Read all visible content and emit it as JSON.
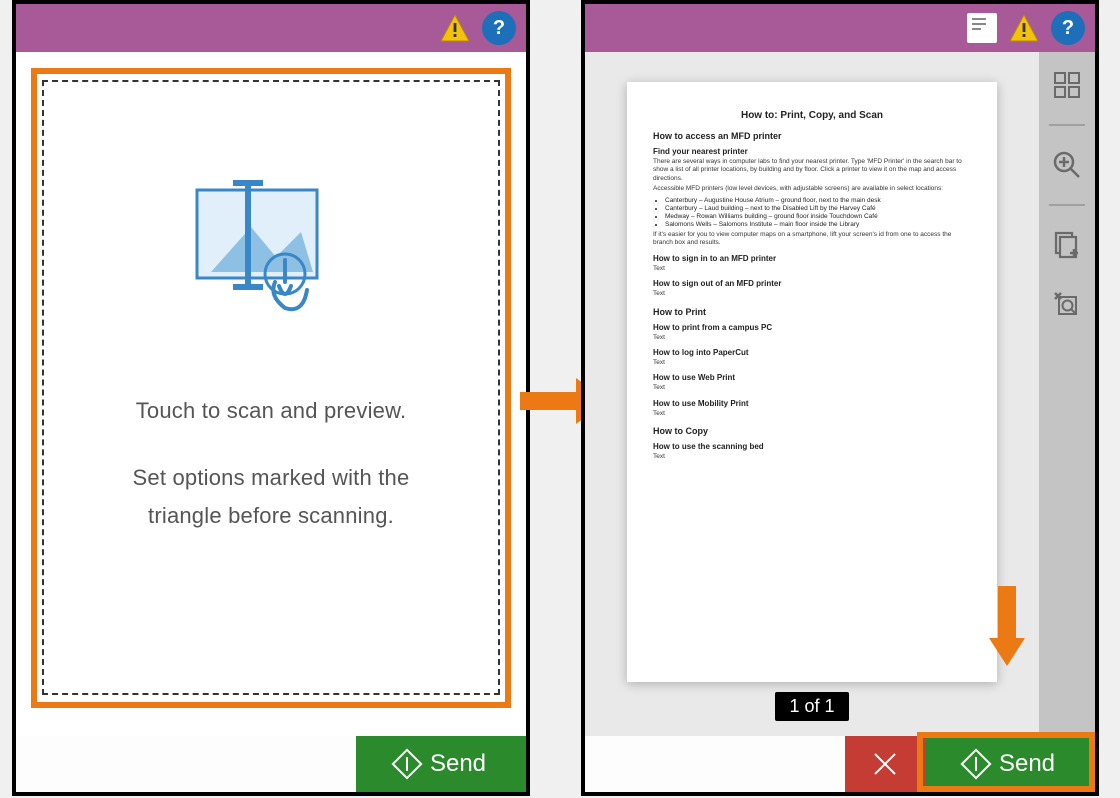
{
  "colors": {
    "header_purple": "#a75a97",
    "highlight_orange": "#ec7a14",
    "send_green": "#2b8a2b",
    "cancel_red": "#c43c33",
    "help_blue": "#1d6fba"
  },
  "icons": {
    "warning": "warning-triangle",
    "help": "help-circle",
    "document": "document-icon",
    "grid": "grid-icon",
    "zoom_in": "zoom-in-icon",
    "add_page": "add-page-icon",
    "clear_crop": "clear-crop-icon",
    "close": "close-x-icon",
    "send_marker": "diamond-send-icon"
  },
  "left": {
    "instruction_line1": "Touch to scan and preview.",
    "instruction_line2a": "Set options marked with the",
    "instruction_line2b": "triangle before scanning.",
    "send_label": "Send"
  },
  "right": {
    "page_counter": "1 of 1",
    "send_label": "Send",
    "document": {
      "title": "How to: Print, Copy, and Scan",
      "h2_access": "How to access an MFD printer",
      "h3_find": "Find your nearest printer",
      "p_find": "There are several ways in computer labs to find your nearest printer. Type 'MFD Printer' in the search bar to show a list of all printer locations, by building and by floor. Click a printer to view it on the map and access directions.",
      "p_accessible": "Accessible MFD printers (low level devices, with adjustable screens) are available in select locations:",
      "bullets": [
        "Canterbury – Augustine House Atrium – ground floor, next to the main desk",
        "Canterbury – Laud building – next to the Disabled Lift by the Harvey Café",
        "Medway – Rowan Williams building – ground floor inside Touchdown Café",
        "Salomons Wells – Salomons Institute – main floor inside the Library"
      ],
      "p_view": "If it's easier for you to view computer maps on a smartphone, lift your screen's id from one to access the branch box and results.",
      "sections": [
        {
          "h": "How to sign in to an MFD printer",
          "body": "Text"
        },
        {
          "h": "How to sign out of an MFD printer",
          "body": "Text"
        }
      ],
      "h2_print": "How to Print",
      "print_sections": [
        {
          "h": "How to print from a campus PC",
          "body": "Text"
        },
        {
          "h": "How to log into PaperCut",
          "body": "Text"
        },
        {
          "h": "How to use Web Print",
          "body": "Text"
        },
        {
          "h": "How to use Mobility Print",
          "body": "Text"
        }
      ],
      "h2_copy": "How to Copy",
      "copy_sections": [
        {
          "h": "How to use the scanning bed",
          "body": "Text"
        }
      ]
    }
  }
}
